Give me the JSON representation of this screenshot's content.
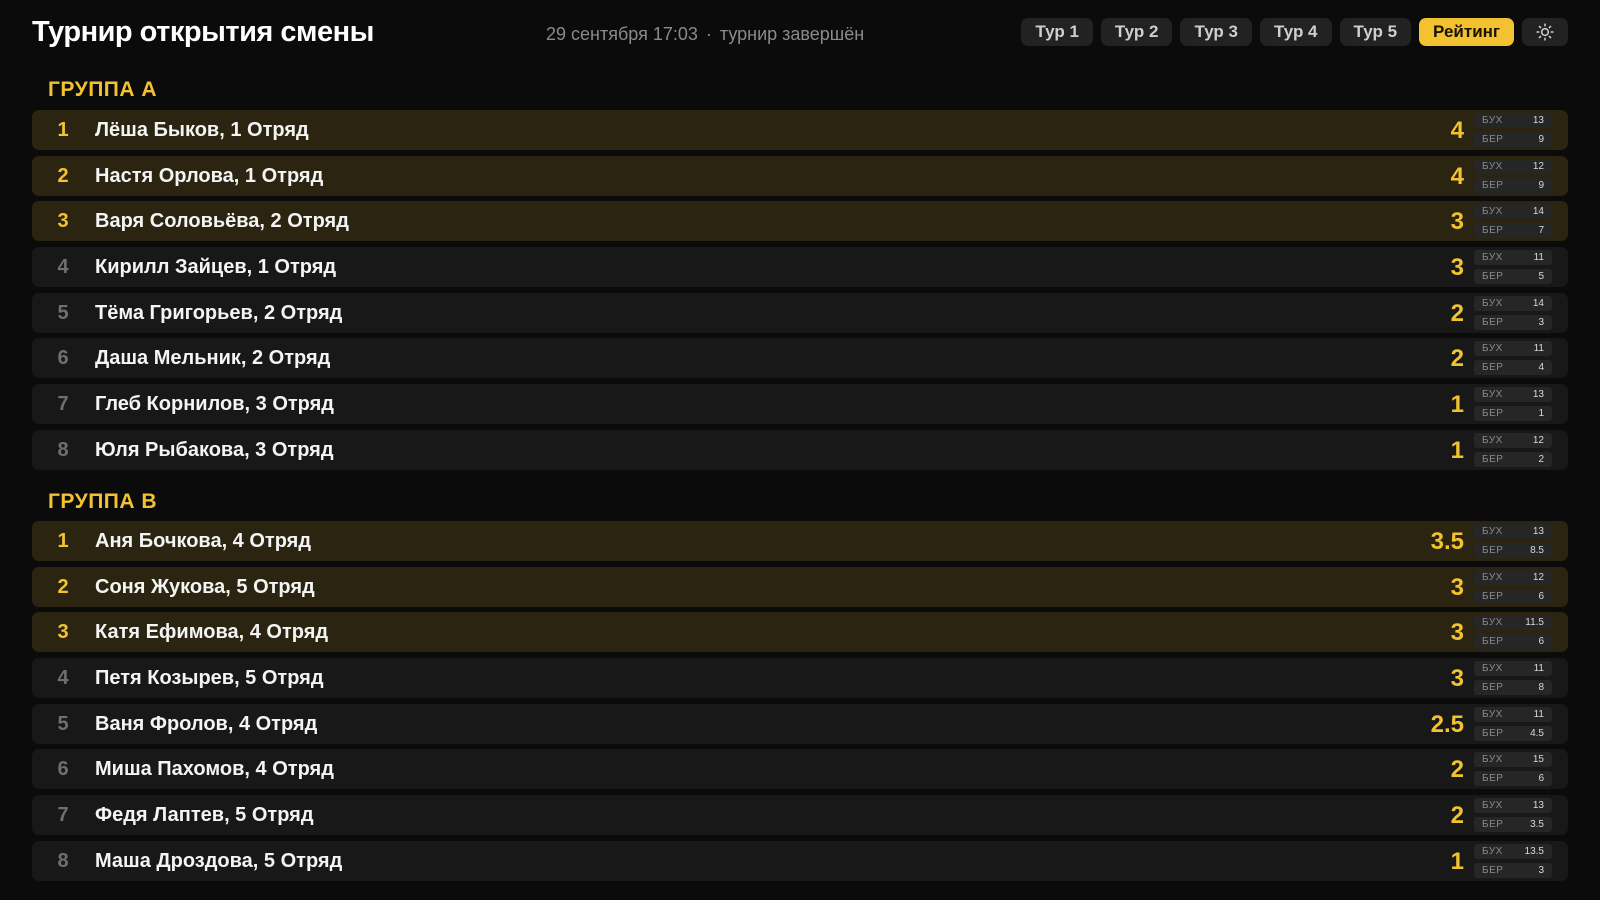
{
  "header": {
    "title": "Турнир открытия смены",
    "datetime": "29 сентября 17:03",
    "separator": "·",
    "status": "турнир завершён"
  },
  "tabs": [
    {
      "label": "Тур 1",
      "active": false
    },
    {
      "label": "Тур 2",
      "active": false
    },
    {
      "label": "Тур 3",
      "active": false
    },
    {
      "label": "Тур 4",
      "active": false
    },
    {
      "label": "Тур 5",
      "active": false
    },
    {
      "label": "Рейтинг",
      "active": true
    }
  ],
  "theme_toggle_icon": "sun-icon",
  "colors": {
    "accent": "#f2c230",
    "background": "#0b0b0b",
    "row": "#181818",
    "row_top": "#2a2410"
  },
  "tiebreak_labels": {
    "buch": "БУХ",
    "berger": "БЕР"
  },
  "groups": [
    {
      "title": "ГРУППА А",
      "rows": [
        {
          "place": "1",
          "name": "Лёша Быков, 1 Отряд",
          "score": "4",
          "buch": "13",
          "berger": "9",
          "top": true
        },
        {
          "place": "2",
          "name": "Настя Орлова, 1 Отряд",
          "score": "4",
          "buch": "12",
          "berger": "9",
          "top": true
        },
        {
          "place": "3",
          "name": "Варя Соловьёва, 2 Отряд",
          "score": "3",
          "buch": "14",
          "berger": "7",
          "top": true
        },
        {
          "place": "4",
          "name": "Кирилл Зайцев, 1 Отряд",
          "score": "3",
          "buch": "11",
          "berger": "5",
          "top": false
        },
        {
          "place": "5",
          "name": "Тёма Григорьев, 2 Отряд",
          "score": "2",
          "buch": "14",
          "berger": "3",
          "top": false
        },
        {
          "place": "6",
          "name": "Даша Мельник, 2 Отряд",
          "score": "2",
          "buch": "11",
          "berger": "4",
          "top": false
        },
        {
          "place": "7",
          "name": "Глеб Корнилов, 3 Отряд",
          "score": "1",
          "buch": "13",
          "berger": "1",
          "top": false
        },
        {
          "place": "8",
          "name": "Юля Рыбакова, 3 Отряд",
          "score": "1",
          "buch": "12",
          "berger": "2",
          "top": false
        }
      ]
    },
    {
      "title": "ГРУППА В",
      "rows": [
        {
          "place": "1",
          "name": "Аня Бочкова, 4 Отряд",
          "score": "3.5",
          "buch": "13",
          "berger": "8.5",
          "top": true
        },
        {
          "place": "2",
          "name": "Соня Жукова, 5 Отряд",
          "score": "3",
          "buch": "12",
          "berger": "6",
          "top": true
        },
        {
          "place": "3",
          "name": "Катя Ефимова, 4 Отряд",
          "score": "3",
          "buch": "11.5",
          "berger": "6",
          "top": true
        },
        {
          "place": "4",
          "name": "Петя Козырев, 5 Отряд",
          "score": "3",
          "buch": "11",
          "berger": "8",
          "top": false
        },
        {
          "place": "5",
          "name": "Ваня Фролов, 4 Отряд",
          "score": "2.5",
          "buch": "11",
          "berger": "4.5",
          "top": false
        },
        {
          "place": "6",
          "name": "Миша Пахомов, 4 Отряд",
          "score": "2",
          "buch": "15",
          "berger": "6",
          "top": false
        },
        {
          "place": "7",
          "name": "Федя Лаптев, 5 Отряд",
          "score": "2",
          "buch": "13",
          "berger": "3.5",
          "top": false
        },
        {
          "place": "8",
          "name": "Маша Дроздова, 5 Отряд",
          "score": "1",
          "buch": "13.5",
          "berger": "3",
          "top": false
        }
      ]
    }
  ]
}
